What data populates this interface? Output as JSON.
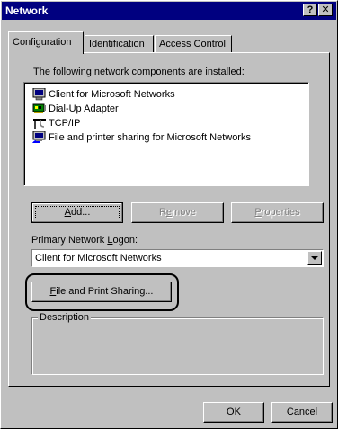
{
  "window": {
    "title": "Network",
    "help_button": "?",
    "close_button": "✕"
  },
  "tabs": [
    {
      "label": "Configuration",
      "active": true
    },
    {
      "label": "Identification",
      "active": false
    },
    {
      "label": "Access Control",
      "active": false
    }
  ],
  "components": {
    "label_pre": "The following ",
    "label_accel": "n",
    "label_post": "etwork components are installed:",
    "items": [
      {
        "label": "Client for Microsoft Networks",
        "icon": "network-client-icon"
      },
      {
        "label": "Dial-Up Adapter",
        "icon": "network-adapter-icon"
      },
      {
        "label": "TCP/IP",
        "icon": "protocol-icon"
      },
      {
        "label": "File and printer sharing for Microsoft Networks",
        "icon": "file-sharing-service-icon"
      }
    ]
  },
  "buttons": {
    "add_accel": "A",
    "add_rest": "dd...",
    "remove_pre": "R",
    "remove_accel": "e",
    "remove_rest": "move",
    "properties_accel": "P",
    "properties_rest": "roperties",
    "file_print_accel": "F",
    "file_print_rest": "ile and Print Sharing...",
    "ok": "OK",
    "cancel": "Cancel"
  },
  "logon": {
    "label_pre": "Primary Network ",
    "label_accel": "L",
    "label_post": "ogon:",
    "selected": "Client for Microsoft Networks"
  },
  "description": {
    "legend": "Description"
  },
  "colors": {
    "titlebar": "#000080",
    "face": "#c0c0c0",
    "highlight": "#ffffff",
    "shadow": "#808080"
  }
}
